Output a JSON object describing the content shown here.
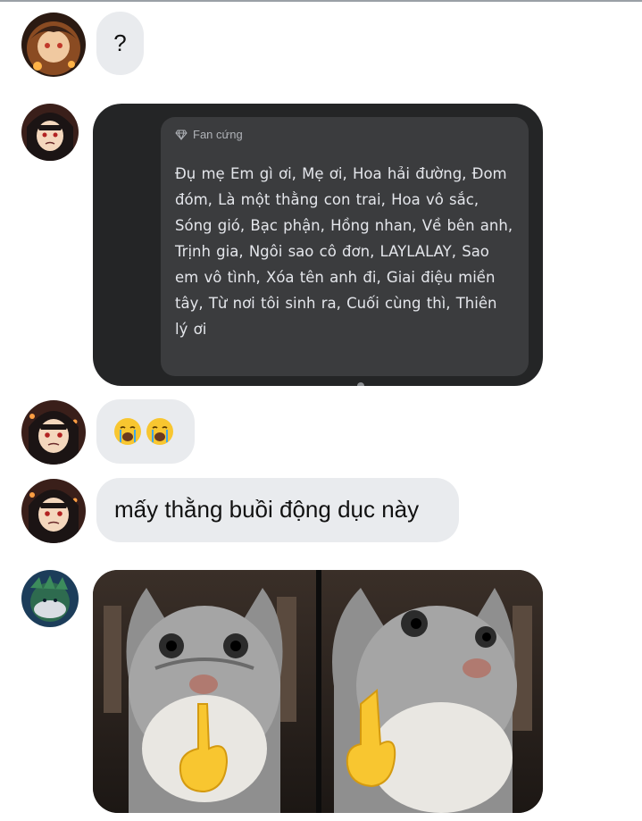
{
  "messages": [
    {
      "type": "text",
      "text": "?"
    },
    {
      "type": "shared-card",
      "card_label": "Fan cứng",
      "card_body": "Đụ mẹ Em gì ơi, Mẹ ơi, Hoa hải đường, Đom đóm, Là một thằng con trai, Hoa vô sắc, Sóng gió, Bạc phận, Hồng nhan, Về bên anh, Trịnh gia, Ngôi sao cô đơn, LAYLALAY, Sao em vô tình, Xóa tên anh đi, Giai điệu miền tây, Từ nơi tôi sinh ra, Cuối cùng thì, Thiên lý ơi"
    },
    {
      "type": "reaction",
      "emoji": [
        "loudly-crying-face",
        "loudly-crying-face"
      ]
    },
    {
      "type": "text",
      "text": "mấy thằng buồi động dục này"
    },
    {
      "type": "image",
      "subject": "cat-shushing-meme"
    }
  ],
  "colors": {
    "bubble_bg": "#e9ebee",
    "card_bg": "#242526",
    "inner_card_bg": "#3b3c3e",
    "emoji_yellow": "#f8c630",
    "tear_blue": "#3fa5e8"
  }
}
